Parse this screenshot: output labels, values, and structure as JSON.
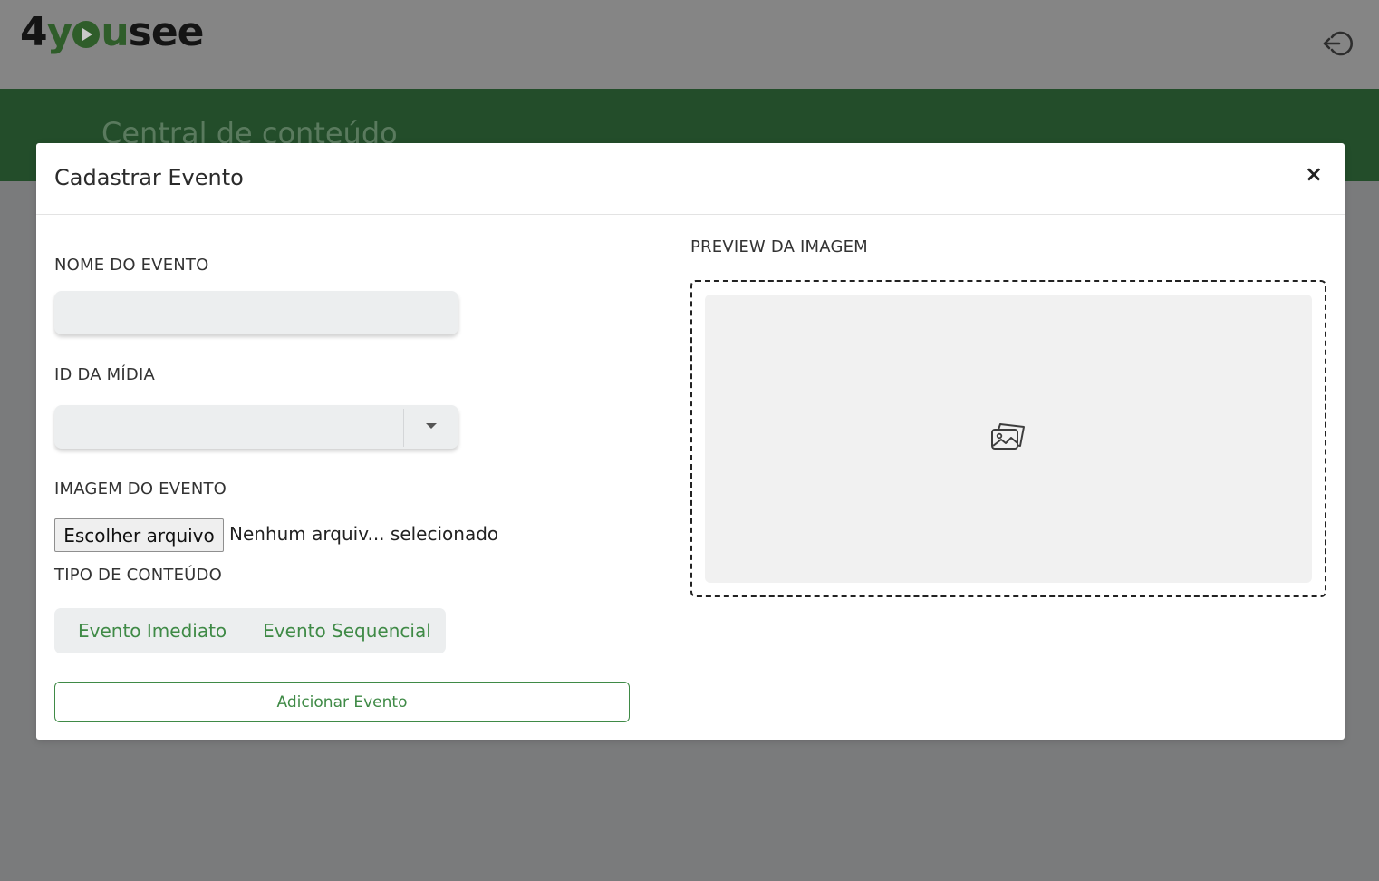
{
  "app": {
    "logo_parts": {
      "four": "4",
      "you_y": "y",
      "you_u": "u",
      "see": "see"
    },
    "background_title": "Central de conteúdo",
    "logout_icon": "logout-icon"
  },
  "modal": {
    "title": "Cadastrar Evento",
    "close_label": "×",
    "fields": {
      "event_name_label": "NOME DO EVENTO",
      "event_name_value": "",
      "media_id_label": "ID DA MÍDIA",
      "media_id_value": "",
      "event_image_label": "IMAGEM DO EVENTO",
      "file_button_label": "Escolher arquivo",
      "file_status": "Nenhum arquiv... selecionado",
      "content_type_label": "TIPO DE CONTEÚDO",
      "content_type_options": [
        "Evento Imediato",
        "Evento Sequencial"
      ]
    },
    "submit_label": "Adicionar Evento",
    "preview": {
      "label": "PREVIEW DA IMAGEM",
      "placeholder_icon": "image-placeholder-icon"
    }
  },
  "colors": {
    "accent_green": "#3f8a46",
    "header_green": "#234d2a",
    "overlay_gray": "#7a7b7c"
  }
}
